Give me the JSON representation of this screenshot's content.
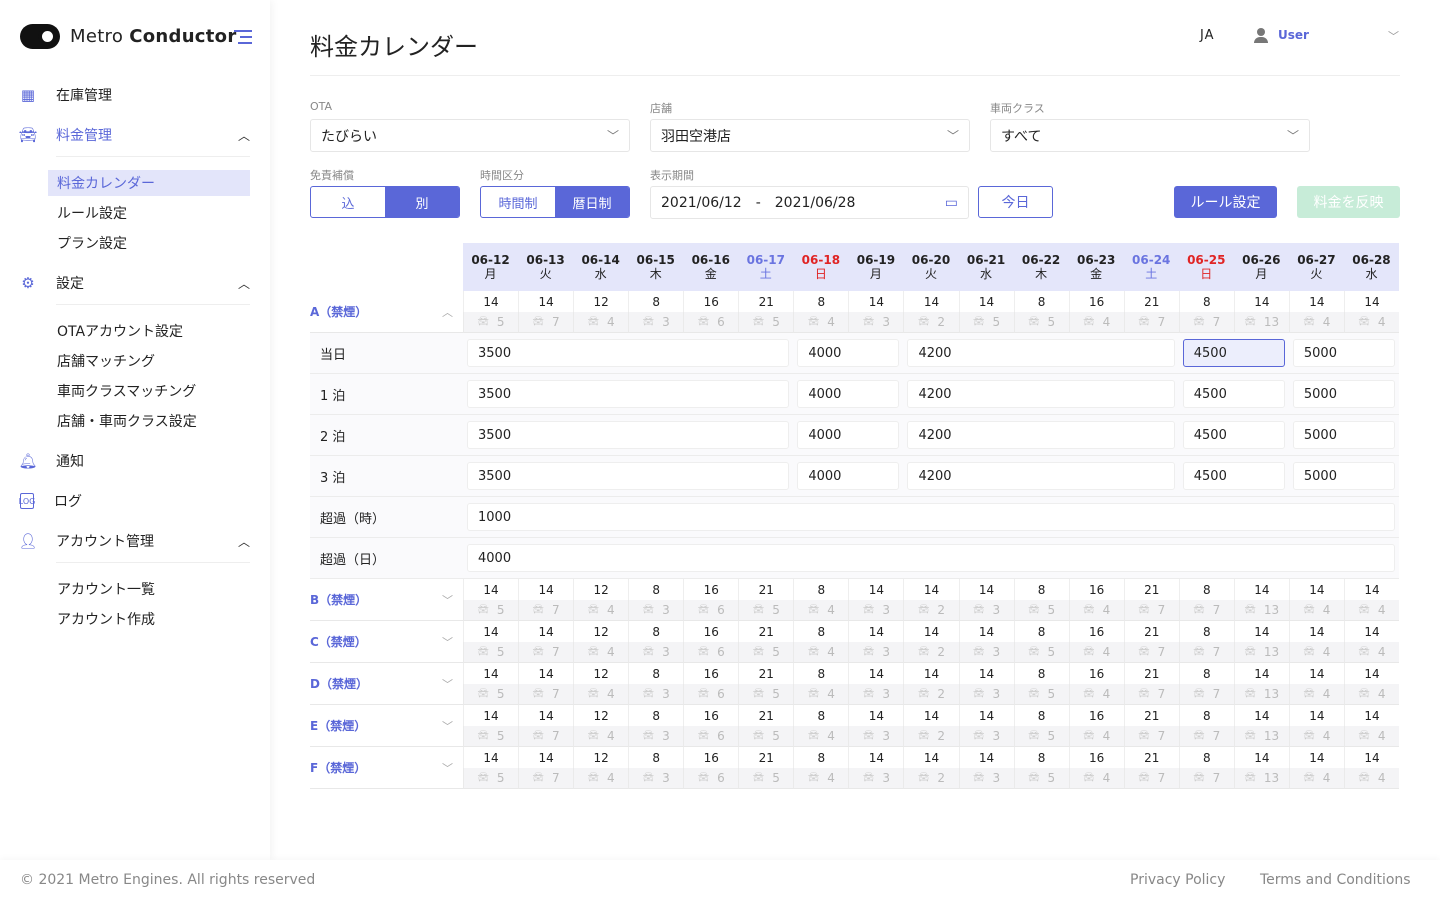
{
  "app": {
    "name_light": "Metro",
    "name_bold": "Conductor"
  },
  "sidebar": {
    "items": [
      {
        "label": "在庫管理",
        "icon": "grid-icon"
      },
      {
        "label": "料金管理",
        "icon": "car-icon"
      },
      {
        "label": "設定",
        "icon": "gear-icon"
      },
      {
        "label": "通知",
        "icon": "bell-icon"
      },
      {
        "label": "ログ",
        "icon": "log-icon"
      },
      {
        "label": "アカウント管理",
        "icon": "user-icon"
      }
    ],
    "pricing_sub": [
      "料金カレンダー",
      "ルール設定",
      "プラン設定"
    ],
    "settings_sub": [
      "OTAアカウント設定",
      "店舗マッチング",
      "車両クラスマッチング",
      "店舗・車両クラス設定"
    ],
    "account_sub": [
      "アカウント一覧",
      "アカウント作成"
    ]
  },
  "header": {
    "title": "料金カレンダー",
    "lang": "JA",
    "user": "User"
  },
  "filters": {
    "ota_label": "OTA",
    "ota_value": "たびらい",
    "store_label": "店舗",
    "store_value": "羽田空港店",
    "class_label": "車両クラス",
    "class_value": "すべて",
    "insurance_label": "免責補償",
    "insurance_options": [
      "込",
      "別"
    ],
    "insurance_selected": "別",
    "time_label": "時間区分",
    "time_options": [
      "時間制",
      "暦日制"
    ],
    "time_selected": "暦日制",
    "period_label": "表示期間",
    "start": "2021/06/12",
    "sep": "-",
    "end": "2021/06/28",
    "today": "今日",
    "rule": "ルール設定",
    "apply": "料金を反映"
  },
  "colors": {
    "accent": "#5a67d8",
    "sunday": "#e02424",
    "saturday": "#6a74e0",
    "apply_disabled": "#c7ecd8"
  },
  "dates": [
    {
      "d": "06-12",
      "w": "月",
      "t": ""
    },
    {
      "d": "06-13",
      "w": "火",
      "t": ""
    },
    {
      "d": "06-14",
      "w": "水",
      "t": ""
    },
    {
      "d": "06-15",
      "w": "木",
      "t": ""
    },
    {
      "d": "06-16",
      "w": "金",
      "t": ""
    },
    {
      "d": "06-17",
      "w": "土",
      "t": "sat"
    },
    {
      "d": "06-18",
      "w": "日",
      "t": "sun"
    },
    {
      "d": "06-19",
      "w": "月",
      "t": ""
    },
    {
      "d": "06-20",
      "w": "火",
      "t": ""
    },
    {
      "d": "06-21",
      "w": "水",
      "t": ""
    },
    {
      "d": "06-22",
      "w": "木",
      "t": ""
    },
    {
      "d": "06-23",
      "w": "金",
      "t": ""
    },
    {
      "d": "06-24",
      "w": "土",
      "t": "sat"
    },
    {
      "d": "06-25",
      "w": "日",
      "t": "sun"
    },
    {
      "d": "06-26",
      "w": "月",
      "t": ""
    },
    {
      "d": "06-27",
      "w": "火",
      "t": ""
    },
    {
      "d": "06-28",
      "w": "水",
      "t": ""
    }
  ],
  "groups": [
    {
      "name": "A（禁煙）",
      "expanded": true,
      "counts": [
        14,
        14,
        12,
        8,
        16,
        21,
        8,
        14,
        14,
        14,
        8,
        16,
        21,
        8,
        14,
        14,
        14
      ],
      "cars": [
        5,
        7,
        4,
        3,
        6,
        5,
        4,
        3,
        2,
        5,
        5,
        4,
        7,
        7,
        13,
        4,
        4
      ],
      "prices": [
        {
          "label": "当日",
          "segments": [
            {
              "span": 6,
              "value": "3500"
            },
            {
              "span": 2,
              "value": "4000"
            },
            {
              "span": 5,
              "value": "4200"
            },
            {
              "span": 2,
              "value": "4500",
              "selected": true
            },
            {
              "span": 2,
              "value": "5000"
            }
          ]
        },
        {
          "label": "1 泊",
          "segments": [
            {
              "span": 6,
              "value": "3500"
            },
            {
              "span": 2,
              "value": "4000"
            },
            {
              "span": 5,
              "value": "4200"
            },
            {
              "span": 2,
              "value": "4500"
            },
            {
              "span": 2,
              "value": "5000"
            }
          ]
        },
        {
          "label": "2 泊",
          "segments": [
            {
              "span": 6,
              "value": "3500"
            },
            {
              "span": 2,
              "value": "4000"
            },
            {
              "span": 5,
              "value": "4200"
            },
            {
              "span": 2,
              "value": "4500"
            },
            {
              "span": 2,
              "value": "5000"
            }
          ]
        },
        {
          "label": "3 泊",
          "segments": [
            {
              "span": 6,
              "value": "3500"
            },
            {
              "span": 2,
              "value": "4000"
            },
            {
              "span": 5,
              "value": "4200"
            },
            {
              "span": 2,
              "value": "4500"
            },
            {
              "span": 2,
              "value": "5000"
            }
          ]
        },
        {
          "label": "超過（時）",
          "segments": [
            {
              "span": 17,
              "value": "1000"
            }
          ]
        },
        {
          "label": "超過（日）",
          "segments": [
            {
              "span": 17,
              "value": "4000"
            }
          ]
        }
      ]
    },
    {
      "name": "B（禁煙）",
      "expanded": false,
      "counts": [
        14,
        14,
        12,
        8,
        16,
        21,
        8,
        14,
        14,
        14,
        8,
        16,
        21,
        8,
        14,
        14,
        14
      ],
      "cars": [
        5,
        7,
        4,
        3,
        6,
        5,
        4,
        3,
        2,
        3,
        5,
        4,
        7,
        7,
        13,
        4,
        4
      ]
    },
    {
      "name": "C（禁煙）",
      "expanded": false,
      "counts": [
        14,
        14,
        12,
        8,
        16,
        21,
        8,
        14,
        14,
        14,
        8,
        16,
        21,
        8,
        14,
        14,
        14
      ],
      "cars": [
        5,
        7,
        4,
        3,
        6,
        5,
        4,
        3,
        2,
        3,
        5,
        4,
        7,
        7,
        13,
        4,
        4
      ]
    },
    {
      "name": "D（禁煙）",
      "expanded": false,
      "counts": [
        14,
        14,
        12,
        8,
        16,
        21,
        8,
        14,
        14,
        14,
        8,
        16,
        21,
        8,
        14,
        14,
        14
      ],
      "cars": [
        5,
        7,
        4,
        3,
        6,
        5,
        4,
        3,
        2,
        3,
        5,
        4,
        7,
        7,
        13,
        4,
        4
      ]
    },
    {
      "name": "E（禁煙）",
      "expanded": false,
      "counts": [
        14,
        14,
        12,
        8,
        16,
        21,
        8,
        14,
        14,
        14,
        8,
        16,
        21,
        8,
        14,
        14,
        14
      ],
      "cars": [
        5,
        7,
        4,
        3,
        6,
        5,
        4,
        3,
        2,
        3,
        5,
        4,
        7,
        7,
        13,
        4,
        4
      ]
    },
    {
      "name": "F（禁煙）",
      "expanded": false,
      "counts": [
        14,
        14,
        12,
        8,
        16,
        21,
        8,
        14,
        14,
        14,
        8,
        16,
        21,
        8,
        14,
        14,
        14
      ],
      "cars": [
        5,
        7,
        4,
        3,
        6,
        5,
        4,
        3,
        2,
        3,
        5,
        4,
        7,
        7,
        13,
        4,
        4
      ]
    }
  ],
  "footer": {
    "copyright": "© 2021 Metro Engines. All rights reserved",
    "privacy": "Privacy Policy",
    "terms": "Terms and Conditions"
  }
}
